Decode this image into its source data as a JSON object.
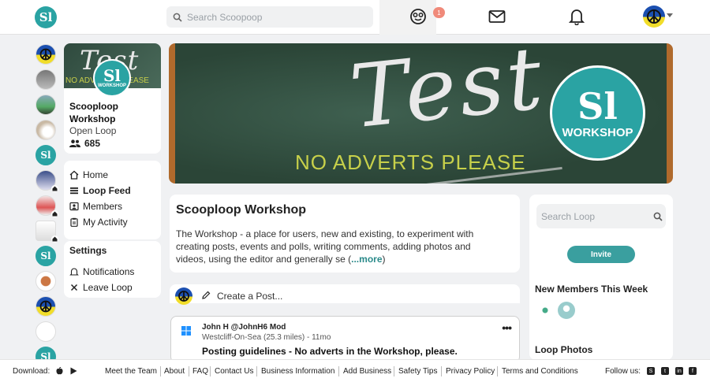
{
  "header": {
    "logo_text": "Sl",
    "search_placeholder": "Search Scoopoop",
    "notification_count": "1",
    "icons": [
      "scoopoop-face-icon",
      "mail-icon",
      "bell-icon"
    ]
  },
  "rail": {
    "logo_text": "Sl",
    "items": [
      "peace-avatar",
      "romford-avatar",
      "landscape-avatar",
      "dog-avatar",
      "scoopoop-avatar",
      "welling-avatar",
      "map-avatar",
      "welcome-avatar",
      "scoopoop-avatar-2",
      "food-avatar",
      "peace-avatar-2",
      "text-avatar",
      "scoopoop-avatar-3"
    ]
  },
  "profile": {
    "banner_word": "Test",
    "banner_note": "NO ADVERTS PLEASE",
    "logo_text": "Sl",
    "logo_sub": "WORKSHOP",
    "name": "Scooploop Workshop",
    "type": "Open Loop",
    "members": "685"
  },
  "menu": {
    "home": "Home",
    "feed": "Loop Feed",
    "members": "Members",
    "activity": "My Activity",
    "settings_head": "Settings",
    "notifications": "Notifications",
    "leave": "Leave Loop"
  },
  "hero": {
    "word": "Test",
    "note": "NO ADVERTS PLEASE",
    "logo_text": "Sl",
    "logo_sub": "WORKSHOP"
  },
  "about": {
    "title": "Scooploop Workshop",
    "body": "The Workshop - a place for users, new and existing, to experiment with creating posts, events and polls, writing comments, adding photos and videos, using the editor and generally se (",
    "more": "...more",
    "close": ")"
  },
  "composer": {
    "label": "Create a Post..."
  },
  "post": {
    "author": "John H @JohnH6 Mod",
    "location": "Westcliff-On-Sea (25.3 miles) - 11mo",
    "title": "Posting guidelines - No adverts in the Workshop, please.",
    "menu": "•••"
  },
  "sidebar_right": {
    "search_placeholder": "Search Loop",
    "invite": "Invite",
    "new_members": "New Members This Week",
    "loop_photos": "Loop Photos"
  },
  "footer": {
    "download": "Download:",
    "links": [
      "Meet the Team",
      "About",
      "FAQ",
      "Contact Us",
      "Business Information",
      "Add Business",
      "Safety Tips",
      "Privacy Policy",
      "Terms and Conditions"
    ],
    "follow": "Follow us:"
  },
  "colors": {
    "brand": "#2aa3a3",
    "invite": "#3a9f9f",
    "badge": "#f08a7a"
  }
}
